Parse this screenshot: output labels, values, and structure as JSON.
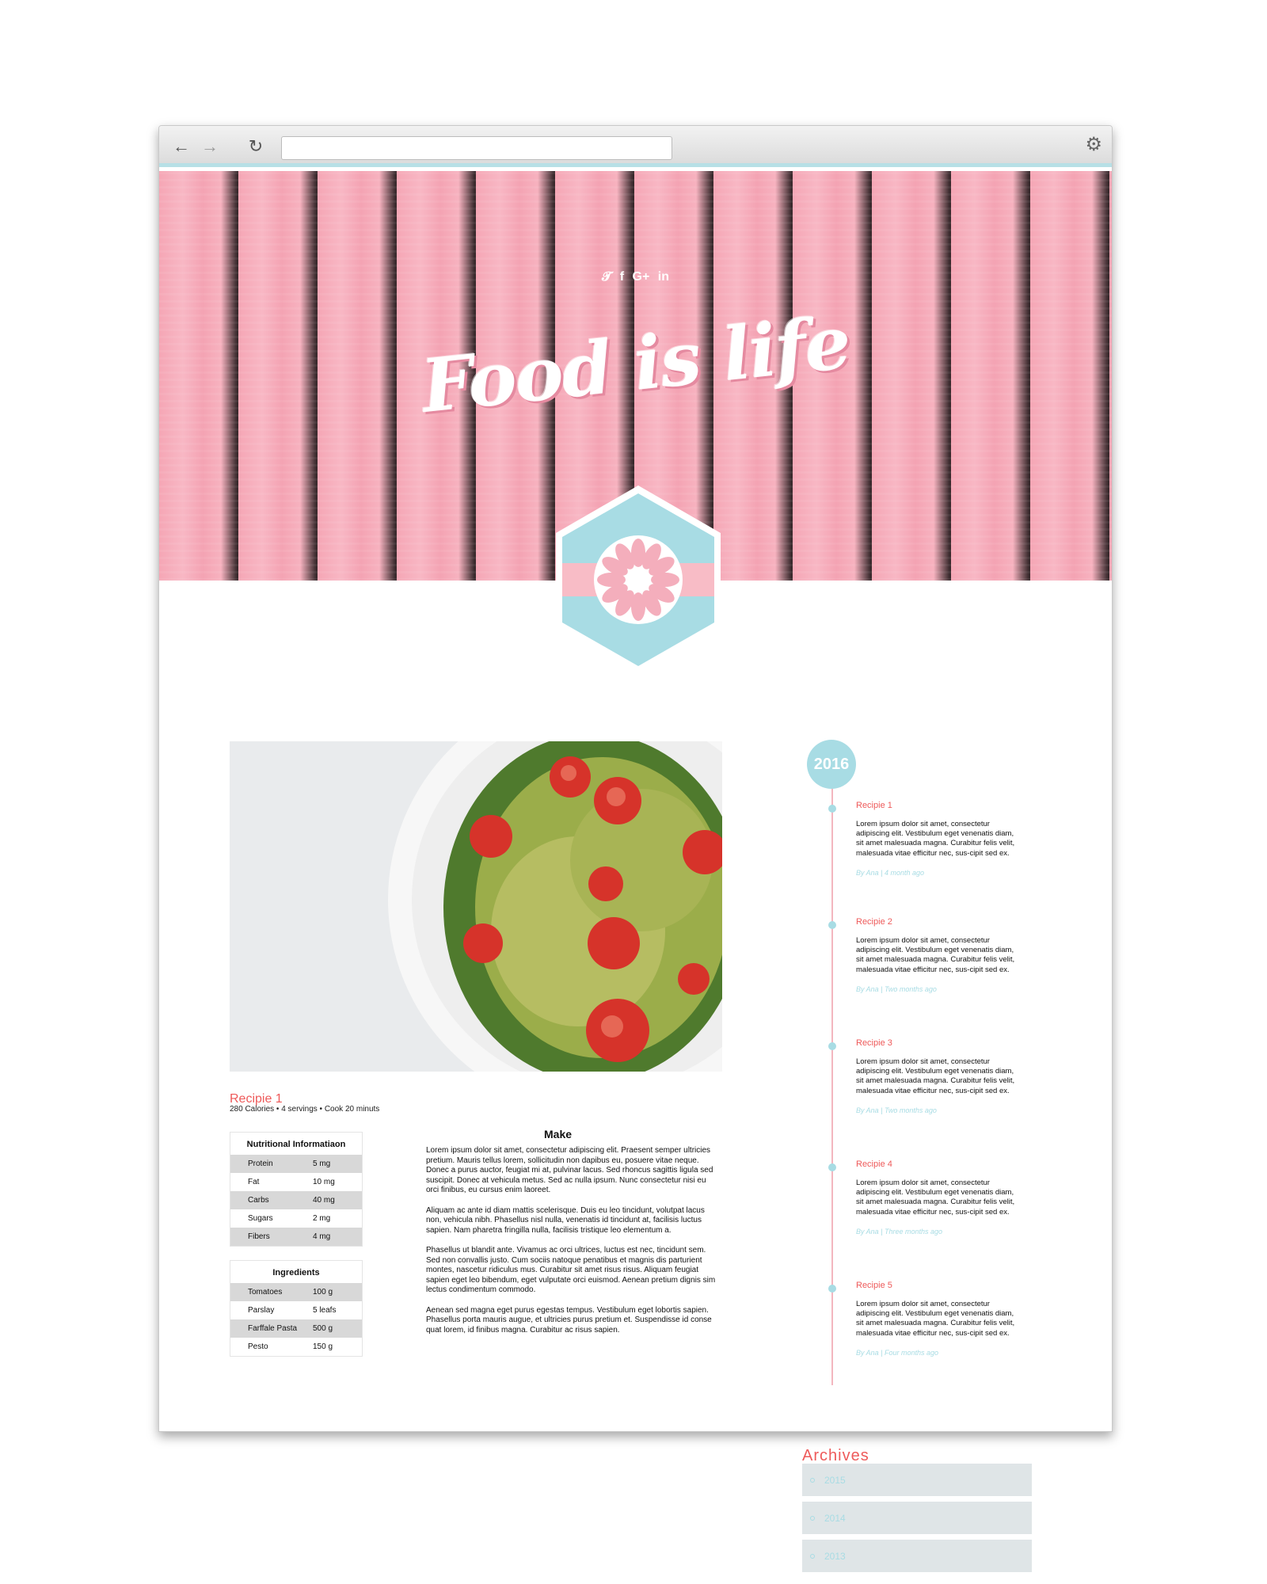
{
  "browser": {
    "url": "",
    "back_icon": "arrow-left-icon",
    "forward_icon": "arrow-right-icon",
    "reload_icon": "reload-icon",
    "settings_icon": "gear-icon"
  },
  "header": {
    "title": "Food is life",
    "social": [
      "twitter-icon",
      "facebook-icon",
      "google-plus-icon",
      "linkedin-icon"
    ]
  },
  "colors": {
    "accent_red": "#ee5a5a",
    "accent_blue": "#a8dce4",
    "wood_pink": "#f5a6b5"
  },
  "recipe": {
    "title": "Recipie 1",
    "meta": "280 Calories •  4 servings • Cook 20 minuts",
    "nutrition": {
      "heading": "Nutritional Informatiaon",
      "rows": [
        {
          "name": "Protein",
          "value": "5 mg"
        },
        {
          "name": "Fat",
          "value": "10 mg"
        },
        {
          "name": "Carbs",
          "value": "40 mg"
        },
        {
          "name": "Sugars",
          "value": "2 mg"
        },
        {
          "name": "Fibers",
          "value": "4 mg"
        }
      ]
    },
    "ingredients": {
      "heading": "Ingredients",
      "rows": [
        {
          "name": "Tomatoes",
          "value": "100 g"
        },
        {
          "name": "Parslay",
          "value": "5 leafs"
        },
        {
          "name": "Farffale Pasta",
          "value": "500 g"
        },
        {
          "name": "Pesto",
          "value": "150 g"
        }
      ]
    },
    "make": {
      "heading": "Make",
      "paragraphs": [
        "Lorem ipsum dolor sit amet, consectetur adipiscing elit. Praesent semper ultricies pretium. Mauris tellus lorem, sollicitudin non dapibus eu, posuere vitae neque. Donec a purus auctor, feugiat mi at, pulvinar lacus. Sed rhoncus sagittis ligula sed suscipit. Donec at vehicula metus. Sed ac nulla ipsum. Nunc consectetur nisi eu orci finibus, eu cursus enim laoreet.",
        "Aliquam ac ante id diam mattis scelerisque. Duis eu leo tincidunt, volutpat lacus non, vehicula nibh. Phasellus nisl nulla, venenatis id tincidunt at, facilisis luctus sapien. Nam pharetra fringilla nulla, facilisis tristique leo elementum a.",
        "Phasellus ut blandit ante. Vivamus ac orci ultrices, luctus est nec, tincidunt sem. Sed non convallis justo. Cum sociis natoque penatibus et magnis dis parturient montes, nascetur ridiculus mus. Curabitur sit amet risus risus. Aliquam feugiat sapien eget leo bibendum, eget vulputate orci euismod. Aenean pretium dignis sim lectus condimentum commodo.",
        "Aenean sed magna eget purus egestas tempus. Vestibulum eget lobortis sapien. Phasellus porta mauris augue, et ultricies purus pretium et. Suspendisse id conse quat lorem, id finibus magna. Curabitur ac risus sapien."
      ]
    }
  },
  "timeline": {
    "year": "2016",
    "items": [
      {
        "title": "Recipie 1",
        "text": "Lorem ipsum dolor sit amet, consectetur adipiscing elit. Vestibulum eget venenatis diam, sit amet malesuada magna. Curabitur felis velit, malesuada vitae efficitur nec, sus-cipit sed ex.",
        "meta": "By Ana | 4 month ago"
      },
      {
        "title": "Recipie 2",
        "text": "Lorem ipsum dolor sit amet, consectetur adipiscing elit. Vestibulum eget venenatis diam, sit amet malesuada magna. Curabitur felis velit, malesuada vitae efficitur nec, sus-cipit sed ex.",
        "meta": "By Ana | Two months ago"
      },
      {
        "title": "Recipie 3",
        "text": "Lorem ipsum dolor sit amet, consectetur adipiscing elit. Vestibulum eget venenatis diam, sit amet malesuada magna. Curabitur felis velit, malesuada vitae efficitur nec, sus-cipit sed ex.",
        "meta": "By Ana | Two months ago"
      },
      {
        "title": "Recipie 4",
        "text": "Lorem ipsum dolor sit amet, consectetur adipiscing elit. Vestibulum eget venenatis diam, sit amet malesuada magna. Curabitur felis velit, malesuada vitae efficitur nec, sus-cipit sed ex.",
        "meta": "By Ana | Three months ago"
      },
      {
        "title": "Recipie 5",
        "text": "Lorem ipsum dolor sit amet, consectetur adipiscing elit. Vestibulum eget venenatis diam, sit amet malesuada magna. Curabitur felis velit, malesuada vitae efficitur nec, sus-cipit sed ex.",
        "meta": "By Ana | Four months ago"
      }
    ]
  },
  "archives": {
    "heading": "Archives",
    "years": [
      "2015",
      "2014",
      "2013"
    ]
  }
}
